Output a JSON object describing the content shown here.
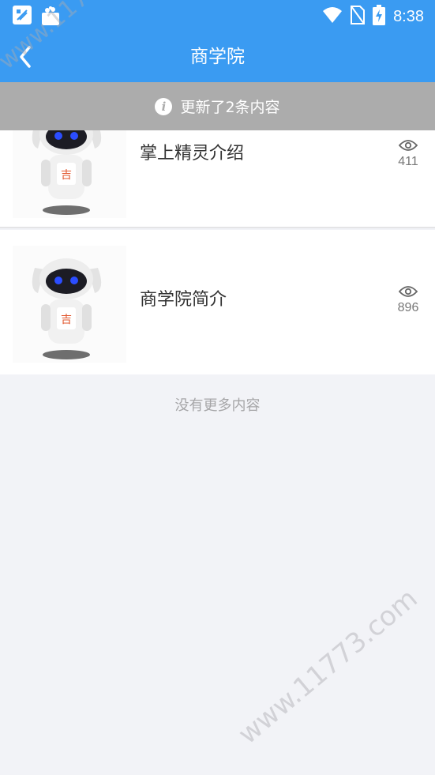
{
  "status_bar": {
    "time": "8:38",
    "left_icons": [
      "app-notification-icon",
      "shopping-bag-icon"
    ],
    "right_icons": [
      "wifi-icon",
      "no-sim-icon",
      "battery-charging-icon"
    ]
  },
  "header": {
    "title": "商学院",
    "back_icon": "chevron-left-icon"
  },
  "toast": {
    "icon": "info-icon",
    "glyph": "i",
    "text": "更新了2条内容"
  },
  "list": {
    "items": [
      {
        "title": "掌上精灵介绍",
        "views": "411",
        "thumb": "robot-mascot-image",
        "badge": "吉"
      },
      {
        "title": "商学院简介",
        "views": "896",
        "thumb": "robot-mascot-image",
        "badge": "吉"
      }
    ]
  },
  "footer": {
    "no_more_text": "没有更多内容"
  },
  "watermark": {
    "text": "www.11773.com"
  },
  "colors": {
    "primary": "#3a9bf2",
    "toast_bg": "#acacac",
    "page_bg": "#f2f3f7",
    "text_primary": "#333333",
    "text_muted": "#a6a6a8"
  }
}
